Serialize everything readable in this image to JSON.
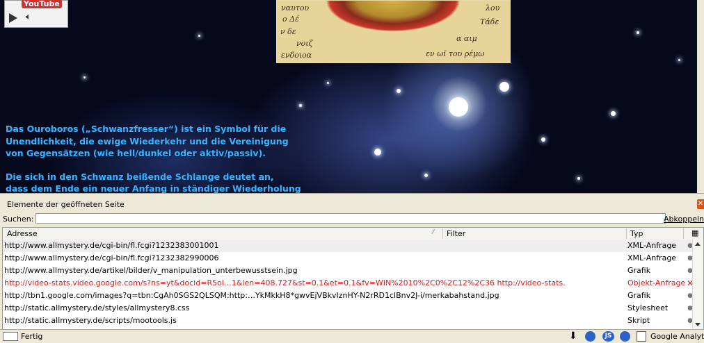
{
  "player": {
    "brand": "YouTube"
  },
  "manuscript": {
    "glyphs": [
      "ναυτου",
      "ο Δέ",
      "ν δε",
      "νοιζ",
      "ενδοιοα",
      "Τάδε",
      "λου",
      "α αιμ",
      "εν ωϊ του ρέμω"
    ]
  },
  "caption": {
    "lines": [
      "Das Ouroboros („Schwanzfresser“) ist ein Symbol für die",
      "Unendlichkeit, die ewige Wiederkehr und die Vereinigung",
      "von Gegensätzen (wie hell/dunkel oder aktiv/passiv).",
      "",
      "Die sich in den Schwanz beißende Schlange deutet an,",
      "dass dem Ende ein neuer Anfang in ständiger Wiederholung"
    ]
  },
  "panel": {
    "title": "Elemente der geöffneten Seite",
    "search_label": "Suchen:",
    "search_value": "",
    "detach_label": "Abkoppeln",
    "columns": {
      "address": "Adresse",
      "filter": "Filter",
      "type": "Typ"
    },
    "rows": [
      {
        "address": "http://www.allmystery.de/cgi-bin/fl.fcgi?1232383001001",
        "type": "XML-Anfrage",
        "state": "selected"
      },
      {
        "address": "http://www.allmystery.de/cgi-bin/fl.fcgi?1232382990006",
        "type": "XML-Anfrage",
        "state": "normal"
      },
      {
        "address": "http://www.allmystery.de/artikel/bilder/v_manipulation_unterbewusstsein.jpg",
        "type": "Grafik",
        "state": "normal"
      },
      {
        "address": "http://video-stats.video.google.com/s?ns=yt&docid=R5ol…1&len=408.727&st=0.1&et=0.1&fv=WIN%2010%2C0%2C12%2C36  http://video-stats.",
        "type": "Objekt-Anfrage",
        "state": "error"
      },
      {
        "address": "http://tbn1.google.com/images?q=tbn:CgAh0SGS2QLSQM:http:…YkMkkH8*gwvEjVBkvIznHY-N2rRD1clBnv2J-i/merkabahstand.jpg",
        "type": "Grafik",
        "state": "normal"
      },
      {
        "address": "http://static.allmystery.de/styles/allmystery8.css",
        "type": "Stylesheet",
        "state": "normal"
      },
      {
        "address": "http://static.allmystery.de/scripts/mootools.js",
        "type": "Skript",
        "state": "normal"
      }
    ]
  },
  "status": {
    "text": "Fertig",
    "js_label": "JS",
    "addon": "Google Analytic"
  },
  "colors": {
    "caption": "#36b6ff",
    "error": "#d21d1d",
    "panel_bg": "#ece9d8"
  }
}
